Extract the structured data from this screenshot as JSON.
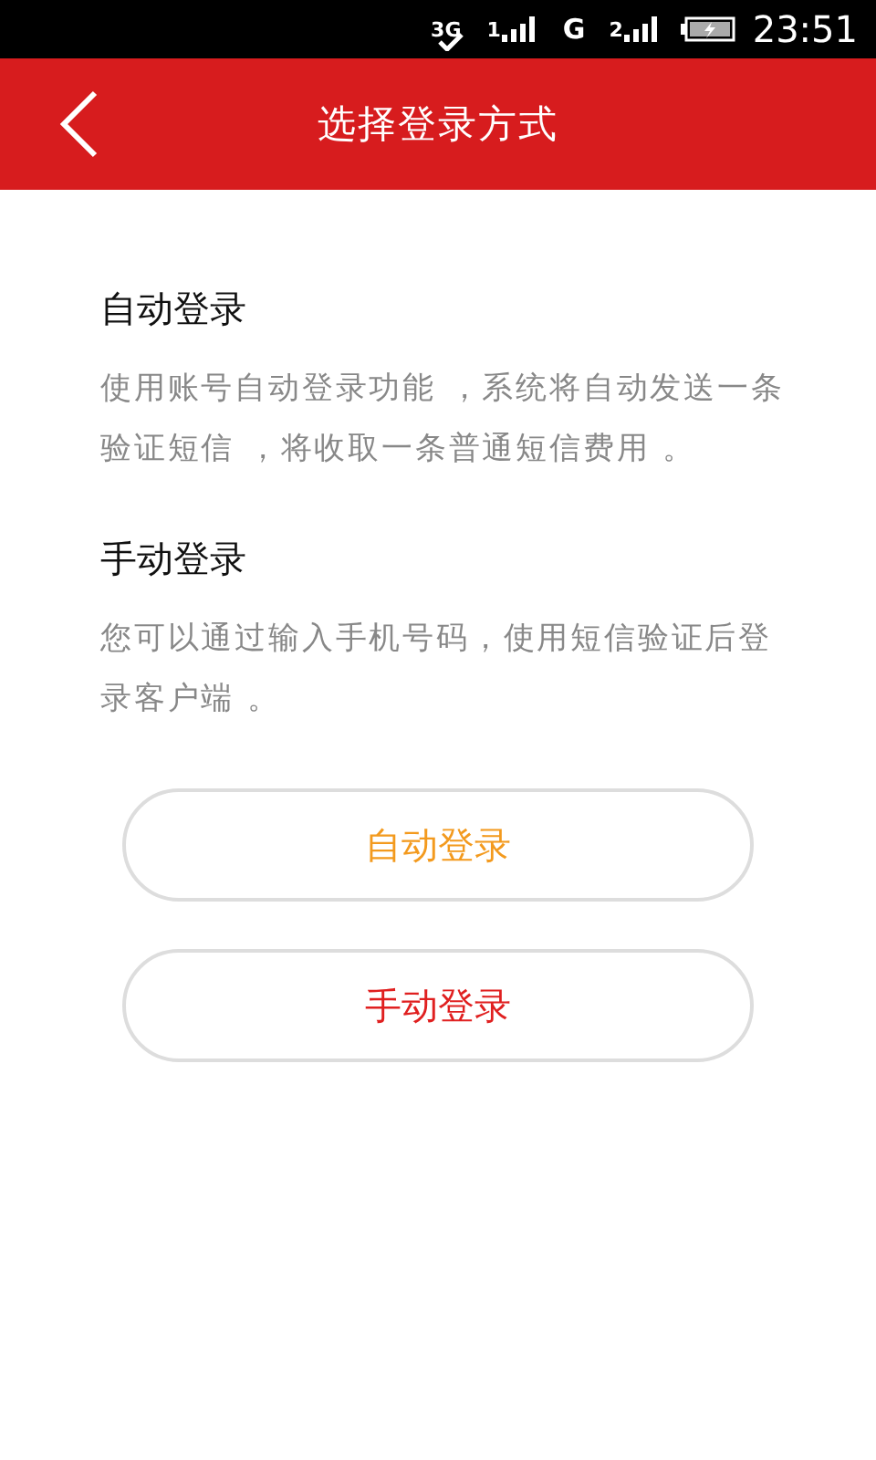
{
  "status_bar": {
    "network": "3G",
    "sim1": "1",
    "g": "G",
    "sim2": "2",
    "time": "23:51"
  },
  "header": {
    "title": "选择登录方式"
  },
  "sections": [
    {
      "title": "自动登录",
      "description": "使用账号自动登录功能 ，系统将自动发送一条验证短信 ，将收取一条普通短信费用 。"
    },
    {
      "title": "手动登录",
      "description": "您可以通过输入手机号码，使用短信验证后登录客户端 。"
    }
  ],
  "buttons": [
    {
      "label": "自动登录",
      "color": "#f39a1e"
    },
    {
      "label": "手动登录",
      "color": "#e02020"
    }
  ]
}
